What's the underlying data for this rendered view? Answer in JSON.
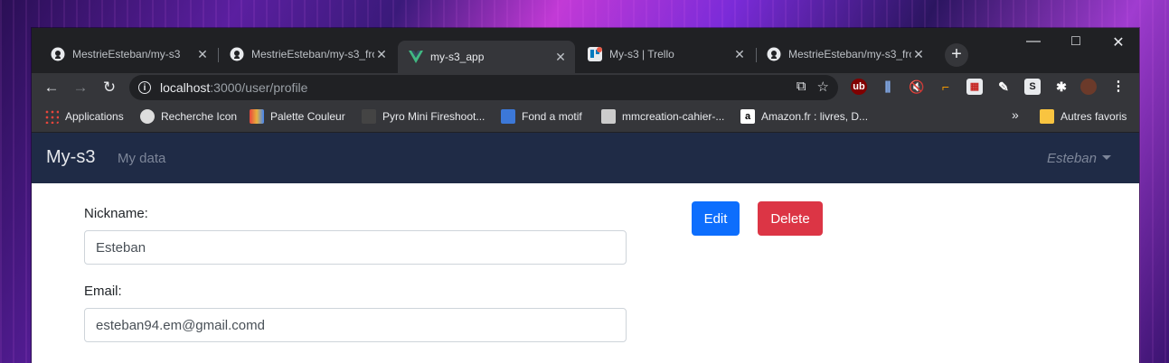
{
  "browser": {
    "tabs": [
      {
        "title": "MestrieEsteban/my-s3",
        "icon": "github-icon"
      },
      {
        "title": "MestrieEsteban/my-s3_fro",
        "icon": "github-icon"
      },
      {
        "title": "my-s3_app",
        "icon": "vue-icon",
        "active": true
      },
      {
        "title": "My-s3 | Trello",
        "icon": "trello-icon"
      },
      {
        "title": "MestrieEsteban/my-s3_fro",
        "icon": "github-icon"
      }
    ],
    "url_host": "localhost",
    "url_path": ":3000/user/profile",
    "bookmarks": [
      {
        "label": "Applications",
        "color": "#e8453c"
      },
      {
        "label": "Recherche Icon",
        "color": "#dddddd"
      },
      {
        "label": "Palette Couleur",
        "color": "#e8b13c"
      },
      {
        "label": "Pyro Mini Fireshoot...",
        "color": "#444444"
      },
      {
        "label": "Fond a motif",
        "color": "#3c78d8"
      },
      {
        "label": "mmcreation-cahier-...",
        "color": "#cccccc"
      },
      {
        "label": "Amazon.fr : livres, D...",
        "color": "#ffffff"
      }
    ],
    "more_bookmarks": "»",
    "other_bookmarks": "Autres favoris"
  },
  "app": {
    "brand": "My-s3",
    "nav_link": "My data",
    "user": "Esteban"
  },
  "profile": {
    "nickname_label": "Nickname:",
    "nickname_value": "Esteban",
    "email_label": "Email:",
    "email_value": "esteban94.em@gmail.comd",
    "edit_label": "Edit",
    "delete_label": "Delete"
  },
  "colors": {
    "navbar": "#1f2b46",
    "edit": "#0d6efd",
    "delete": "#dc3545"
  }
}
